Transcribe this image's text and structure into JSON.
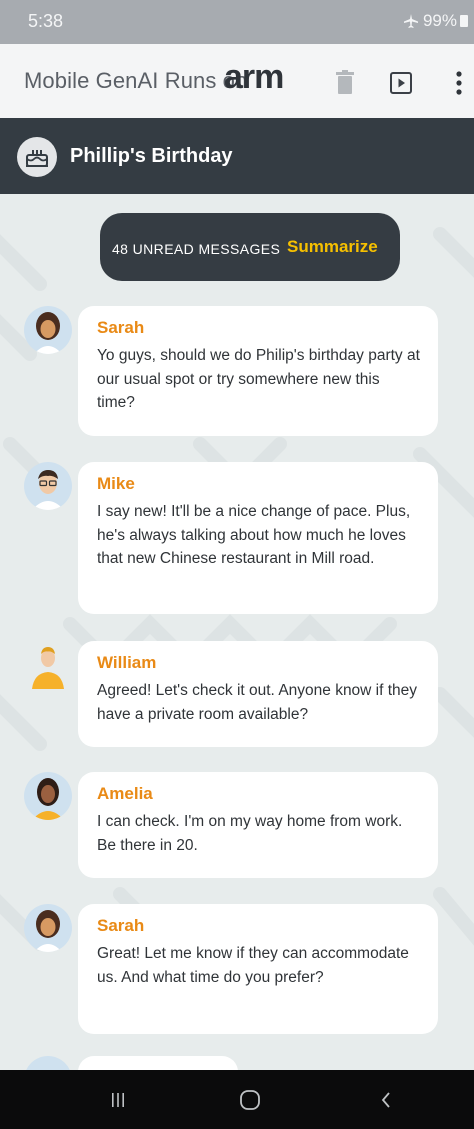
{
  "status_bar": {
    "time": "5:38",
    "battery": "99%",
    "airplane_icon": "airplane-icon",
    "battery_icon": "battery-icon"
  },
  "app_bar": {
    "title": "Mobile GenAI Runs on",
    "logo_text": "arm",
    "icons": [
      "trash-icon",
      "play-icon",
      "more-vert-icon"
    ]
  },
  "chat": {
    "group_name": "Phillip's Birthday",
    "group_icon": "cake-icon",
    "unread_label": "48 UNREAD MESSAGES",
    "summarize_label": "Summarize",
    "messages": [
      {
        "sender": "Sarah",
        "avatar": "avatar-sarah",
        "text": "Yo guys, should we do Philip's birthday party at our usual spot or try somewhere new this time?"
      },
      {
        "sender": "Mike",
        "avatar": "avatar-mike",
        "text": "I say new! It'll be a nice change of pace. Plus, he's always talking about how much he loves that new Chinese restaurant in Mill road."
      },
      {
        "sender": "William",
        "avatar": "avatar-william",
        "text": "Agreed! Let's check it out. Anyone know if they have a private room available?"
      },
      {
        "sender": "Amelia",
        "avatar": "avatar-amelia",
        "text": "I can check. I'm on my way home from work. Be there in 20."
      },
      {
        "sender": "Sarah",
        "avatar": "avatar-sarah",
        "text": "Great! Let me know if they can accommodate us. And what time do you prefer?"
      }
    ]
  },
  "nav_bar": {
    "icons": [
      "recents-icon",
      "home-icon",
      "back-icon"
    ]
  },
  "colors": {
    "header_bg": "#343c43",
    "sender": "#e98a16",
    "summarize": "#f6c000",
    "chat_bg": "#e7ecec"
  }
}
